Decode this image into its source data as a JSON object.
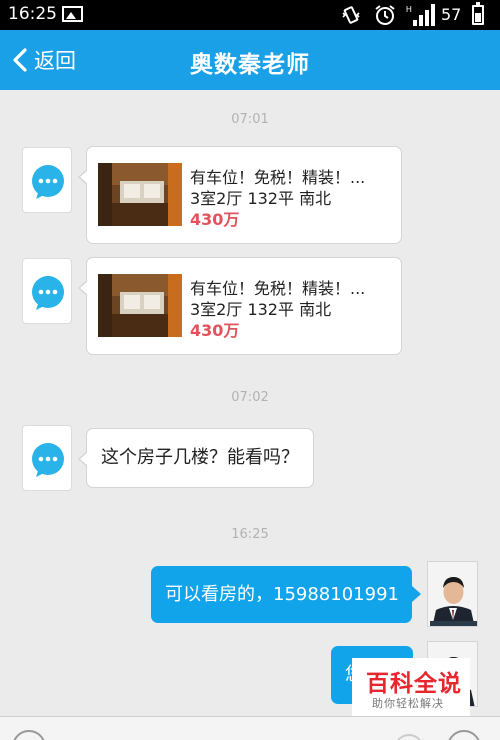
{
  "status_bar": {
    "time": "16:25",
    "battery_level": "57",
    "signal_type": "H",
    "icons": [
      "image-icon",
      "vibrate-icon",
      "alarm-icon",
      "signal-icon",
      "battery-icon"
    ]
  },
  "header": {
    "back_label": "返回",
    "title": "奥数秦老师"
  },
  "messages": [
    {
      "kind": "timestamp",
      "text": "07:01"
    },
    {
      "kind": "listing-card",
      "sender": "other",
      "title": "有车位！免税！精装！...",
      "spec": "3室2厅 132平 南北",
      "price": "430万"
    },
    {
      "kind": "listing-card",
      "sender": "other",
      "title": "有车位！免税！精装！...",
      "spec": "3室2厅 132平 南北",
      "price": "430万"
    },
    {
      "kind": "timestamp",
      "text": "07:02"
    },
    {
      "kind": "text",
      "sender": "other",
      "text": "这个房子几楼？能看吗？"
    },
    {
      "kind": "timestamp",
      "text": "16:25"
    },
    {
      "kind": "text",
      "sender": "me",
      "text": "可以看房的，15988101991"
    },
    {
      "kind": "text",
      "sender": "me",
      "text": "您"
    }
  ],
  "watermark": {
    "title": "百科全说",
    "subtitle": "助你轻松解决"
  },
  "colors": {
    "header_bg": "#1aa0e6",
    "outgoing_bubble": "#12a4ea",
    "price": "#e0535c",
    "chat_bg": "#ebebeb",
    "watermark_red": "#e8262d"
  }
}
